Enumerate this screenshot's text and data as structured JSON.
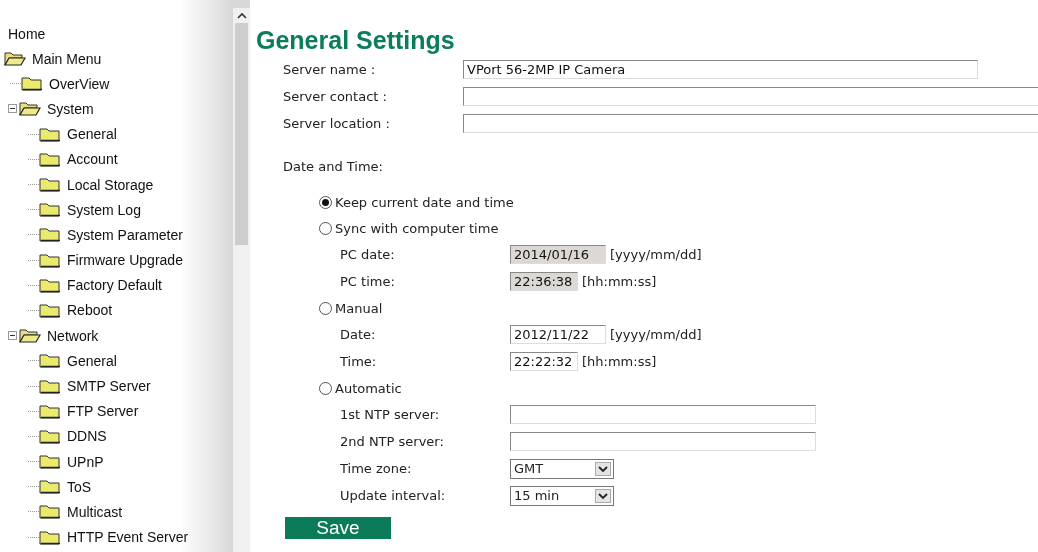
{
  "sidebar": {
    "home": "Home",
    "tree": [
      {
        "label": "Main Menu",
        "children": [
          {
            "label": "OverView"
          },
          {
            "label": "System",
            "children": [
              {
                "label": "General"
              },
              {
                "label": "Account"
              },
              {
                "label": "Local Storage"
              },
              {
                "label": "System Log"
              },
              {
                "label": "System Parameter"
              },
              {
                "label": "Firmware Upgrade"
              },
              {
                "label": "Factory Default"
              },
              {
                "label": "Reboot"
              }
            ]
          },
          {
            "label": "Network",
            "children": [
              {
                "label": "General"
              },
              {
                "label": "SMTP Server"
              },
              {
                "label": "FTP Server"
              },
              {
                "label": "DDNS"
              },
              {
                "label": "UPnP"
              },
              {
                "label": "ToS"
              },
              {
                "label": "Multicast"
              },
              {
                "label": "HTTP Event Server"
              }
            ]
          }
        ]
      }
    ]
  },
  "title": "General Settings",
  "server_fields": [
    {
      "label": "Server name :",
      "value": "VPort 56-2MP IP Camera"
    },
    {
      "label": "Server contact :"
    },
    {
      "label": "Server location :"
    }
  ],
  "date_time": {
    "label": "Date and Time:",
    "options": [
      {
        "label": "Keep current date and time",
        "selected": true
      },
      {
        "label": "Sync with computer time",
        "selected": false,
        "fields": [
          {
            "kind": "date",
            "label": "PC date:",
            "value": "2014/01/16",
            "hint": "[yyyy/mm/dd]",
            "disabled": true
          },
          {
            "kind": "time",
            "label": "PC time:",
            "value": "22:36:38",
            "hint": "[hh:mm:ss]",
            "disabled": true
          }
        ]
      },
      {
        "label": "Manual",
        "selected": false,
        "fields": [
          {
            "kind": "date",
            "label": "Date:",
            "value": "2012/11/22",
            "hint": "[yyyy/mm/dd]",
            "disabled": false
          },
          {
            "kind": "time",
            "label": "Time:",
            "value": "22:22:32",
            "hint": "[hh:mm:ss]",
            "disabled": false
          }
        ]
      },
      {
        "label": "Automatic",
        "selected": false,
        "fields": [
          {
            "kind": "text",
            "label": "1st NTP server:"
          },
          {
            "kind": "text",
            "label": "2nd NTP server:"
          },
          {
            "kind": "select",
            "label": "Time zone:",
            "value": "GMT"
          },
          {
            "kind": "select",
            "label": "Update interval:",
            "value": "15 min"
          }
        ]
      }
    ]
  },
  "save_button": "Save"
}
